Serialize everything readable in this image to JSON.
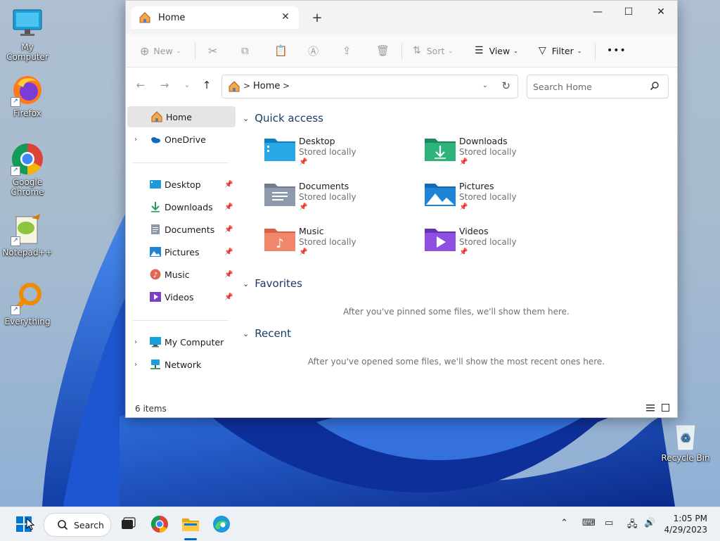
{
  "desktop": {
    "icons": [
      {
        "label": "My Computer"
      },
      {
        "label": "Firefox"
      },
      {
        "label": "Google Chrome"
      },
      {
        "label": "Notepad++"
      },
      {
        "label": "Everything"
      },
      {
        "label": "Recycle Bin"
      }
    ]
  },
  "window": {
    "tab_title": "Home",
    "toolbar": {
      "new_label": "New",
      "sort_label": "Sort",
      "view_label": "View",
      "filter_label": "Filter",
      "more_label": "•••"
    },
    "address": {
      "crumb": "Home",
      "separator": ">"
    },
    "search": {
      "placeholder": "Search Home"
    },
    "sidebar": {
      "items": [
        {
          "label": "Home",
          "icon": "home-icon",
          "selected": true
        },
        {
          "label": "OneDrive",
          "icon": "onedrive-icon"
        },
        {
          "label": "Desktop",
          "icon": "desktop-folder-icon",
          "pinned": true
        },
        {
          "label": "Downloads",
          "icon": "downloads-icon",
          "pinned": true
        },
        {
          "label": "Documents",
          "icon": "documents-icon",
          "pinned": true
        },
        {
          "label": "Pictures",
          "icon": "pictures-icon",
          "pinned": true
        },
        {
          "label": "Music",
          "icon": "music-icon",
          "pinned": true
        },
        {
          "label": "Videos",
          "icon": "videos-icon",
          "pinned": true
        },
        {
          "label": "My Computer",
          "icon": "computer-icon"
        },
        {
          "label": "Network",
          "icon": "network-icon"
        }
      ]
    },
    "quick_access": {
      "title": "Quick access",
      "items": [
        {
          "name": "Desktop",
          "sub": "Stored locally"
        },
        {
          "name": "Downloads",
          "sub": "Stored locally"
        },
        {
          "name": "Documents",
          "sub": "Stored locally"
        },
        {
          "name": "Pictures",
          "sub": "Stored locally"
        },
        {
          "name": "Music",
          "sub": "Stored locally"
        },
        {
          "name": "Videos",
          "sub": "Stored locally"
        }
      ]
    },
    "favorites": {
      "title": "Favorites",
      "empty": "After you've pinned some files, we'll show them here."
    },
    "recent": {
      "title": "Recent",
      "empty": "After you've opened some files, we'll show the most recent ones here."
    },
    "status": {
      "count": "6 items"
    }
  },
  "taskbar": {
    "search_label": "Search",
    "time": "1:05 PM",
    "date": "4/29/2023"
  },
  "colors": {
    "accent": "#0067c0",
    "section_heading": "#1b3a66"
  }
}
